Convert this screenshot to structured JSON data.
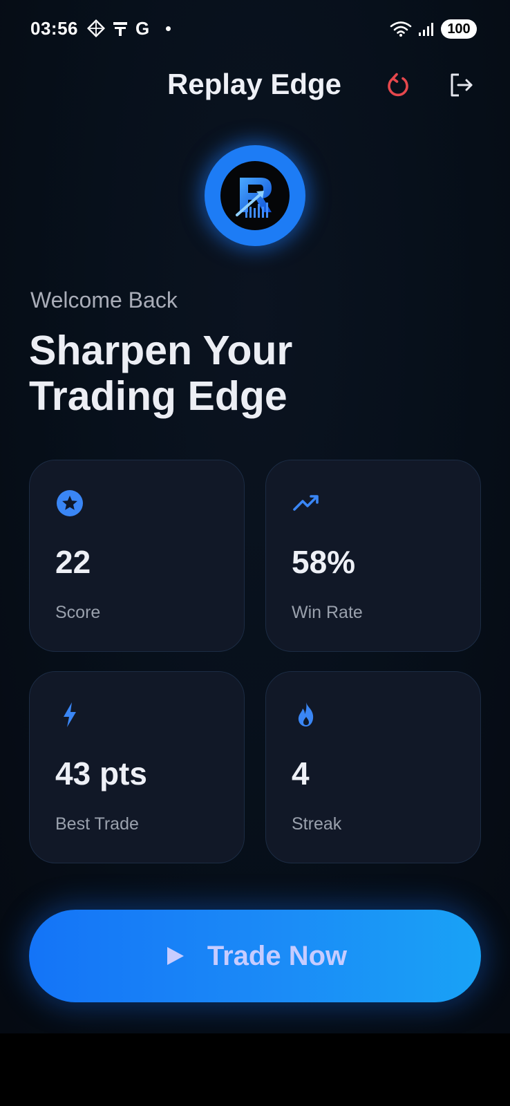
{
  "status_bar": {
    "time": "03:56",
    "g_letter": "G",
    "battery": "100"
  },
  "header": {
    "title": "Replay Edge"
  },
  "logo": {
    "letter": "R"
  },
  "welcome": {
    "subtitle": "Welcome Back",
    "headline_line1": "Sharpen Your",
    "headline_line2": "Trading Edge"
  },
  "stats": [
    {
      "icon": "star-icon",
      "value": "22",
      "label": "Score"
    },
    {
      "icon": "trending-up-icon",
      "value": "58%",
      "label": "Win Rate"
    },
    {
      "icon": "lightning-icon",
      "value": "43 pts",
      "label": "Best Trade"
    },
    {
      "icon": "flame-icon",
      "value": "4",
      "label": "Streak"
    }
  ],
  "actions": {
    "trade_now": "Trade Now"
  },
  "colors": {
    "accent": "#1d7cf5",
    "refresh_icon": "#e5484d",
    "card_bg": "#111827",
    "background": "#07101b"
  }
}
